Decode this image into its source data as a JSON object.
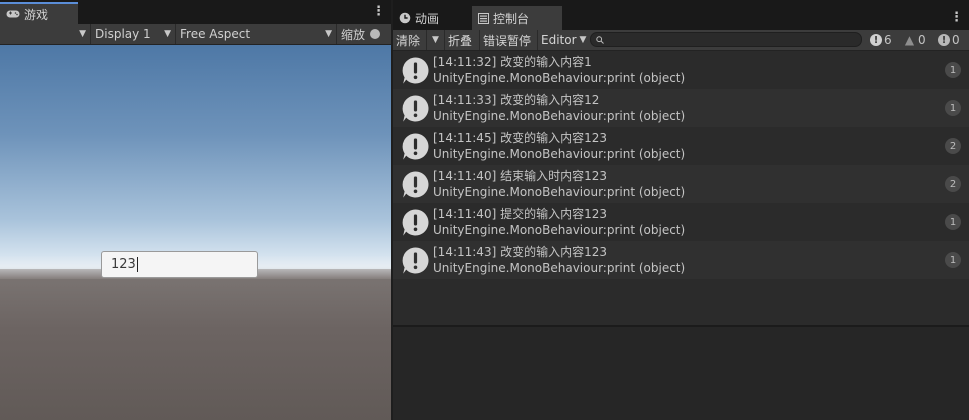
{
  "game": {
    "tab_label": "游戏",
    "tab_icon": "gamepad-icon",
    "display_label": "Display 1",
    "aspect_label": "Free Aspect",
    "scale_label": "缩放",
    "input_value": "123"
  },
  "console": {
    "tabs": [
      {
        "label": "动画",
        "icon": "clock-icon",
        "active": false
      },
      {
        "label": "控制台",
        "icon": "console-icon",
        "active": true
      }
    ],
    "toolbar": {
      "clear_label": "清除",
      "collapse_label": "折叠",
      "error_pause_label": "错误暂停",
      "editor_label": "Editor",
      "info_count": "6",
      "warning_count": "0",
      "error_count": "0"
    },
    "logs": [
      {
        "line1": "[14:11:32] 改变的输入内容1",
        "line2": "UnityEngine.MonoBehaviour:print (object)",
        "count": "1"
      },
      {
        "line1": "[14:11:33] 改变的输入内容12",
        "line2": "UnityEngine.MonoBehaviour:print (object)",
        "count": "1"
      },
      {
        "line1": "[14:11:45] 改变的输入内容123",
        "line2": "UnityEngine.MonoBehaviour:print (object)",
        "count": "2"
      },
      {
        "line1": "[14:11:40] 结束输入时内容123",
        "line2": "UnityEngine.MonoBehaviour:print (object)",
        "count": "2"
      },
      {
        "line1": "[14:11:40] 提交的输入内容123",
        "line2": "UnityEngine.MonoBehaviour:print (object)",
        "count": "1"
      },
      {
        "line1": "[14:11:43] 改变的输入内容123",
        "line2": "UnityEngine.MonoBehaviour:print (object)",
        "count": "1"
      }
    ]
  },
  "colors": {
    "active_tab_accent": "#5b8ed8",
    "panel_bg": "#2b2b2b",
    "toolbar_bg": "#3c3c3c"
  }
}
